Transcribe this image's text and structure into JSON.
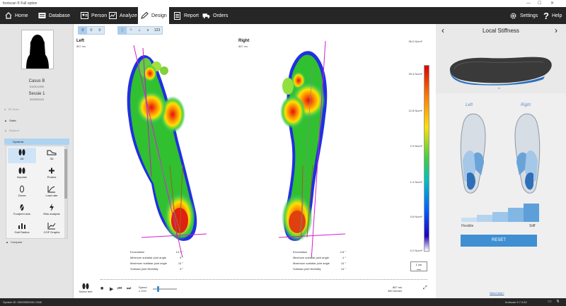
{
  "window": {
    "title": "footscan ® Full option"
  },
  "nav": {
    "tabs": [
      {
        "label": "Home",
        "icon": "home-icon"
      },
      {
        "label": "Database",
        "icon": "database-icon"
      },
      {
        "label": "Person",
        "icon": "person-icon"
      },
      {
        "label": "Analyze",
        "icon": "analyze-icon"
      },
      {
        "label": "Design",
        "icon": "design-icon",
        "active": true
      },
      {
        "label": "Report",
        "icon": "report-icon"
      },
      {
        "label": "Orders",
        "icon": "truck-icon"
      }
    ],
    "settings_label": "Settings",
    "help_label": "Help"
  },
  "patient": {
    "name": "Casus B",
    "dob": "01/01/1999",
    "session": "Sessie 1",
    "session_date": "30/09/2016"
  },
  "left_menu": {
    "scan3d": "3D Scan",
    "static": "Static",
    "balance": "Balance",
    "dynamic": "Dynamic",
    "tools": [
      "2D",
      "3D",
      "Impulse",
      "Probes",
      "Zones",
      "Load rate",
      "Footprint axis",
      "Risk analysis",
      "Gait Radios",
      "COP Graphs"
    ],
    "compare": "Compare"
  },
  "center": {
    "toolbar_right": "123",
    "left_label": "Left",
    "left_time": "867 ms",
    "right_label": "Right",
    "right_time": "867 ms",
    "scale_labels": [
      "36.0 N/cm²",
      "25.4 N/cm²",
      "12.6 N/cm²",
      "2.9 N/cm²",
      "1.4 N/cm²",
      "0.6 N/cm²",
      "0.2 N/cm²"
    ],
    "metrics_left": [
      {
        "k": "Exorotation",
        "v": "14.7 °"
      },
      {
        "k": "Minimum subtalar joint angle",
        "v": "5 °"
      },
      {
        "k": "Maximum subtalar joint angle",
        "v": "14 °"
      },
      {
        "k": "Subtalar joint flexibility",
        "v": "9 °"
      }
    ],
    "metrics_right": [
      {
        "k": "Exorotation",
        "v": "2.8 °"
      },
      {
        "k": "Minimum subtalar joint angle",
        "v": "-1 °"
      },
      {
        "k": "Maximum subtalar joint angle",
        "v": "14 °"
      },
      {
        "k": "Subtalar joint flexibility",
        "v": "14 °"
      }
    ],
    "ruler": "1 cm",
    "select_feet": "Select feet",
    "speed_label": "Speed",
    "speed_value": "x 1/10",
    "frame_time": "867 ms",
    "frame_count": "360 frames"
  },
  "right_panel": {
    "title": "Local Stiffness",
    "left": "Left",
    "right": "Right",
    "flexible": "Flexible",
    "stiff": "Stiff",
    "reset": "RESET",
    "need_help": "Need help?"
  },
  "status": {
    "left": "System ID: 00000000001 0340",
    "right": "footscan 9.7.0.62"
  },
  "colors": {
    "nav_bg": "#262626",
    "accent": "#3f8fd2",
    "selected": "#aed3f0"
  }
}
